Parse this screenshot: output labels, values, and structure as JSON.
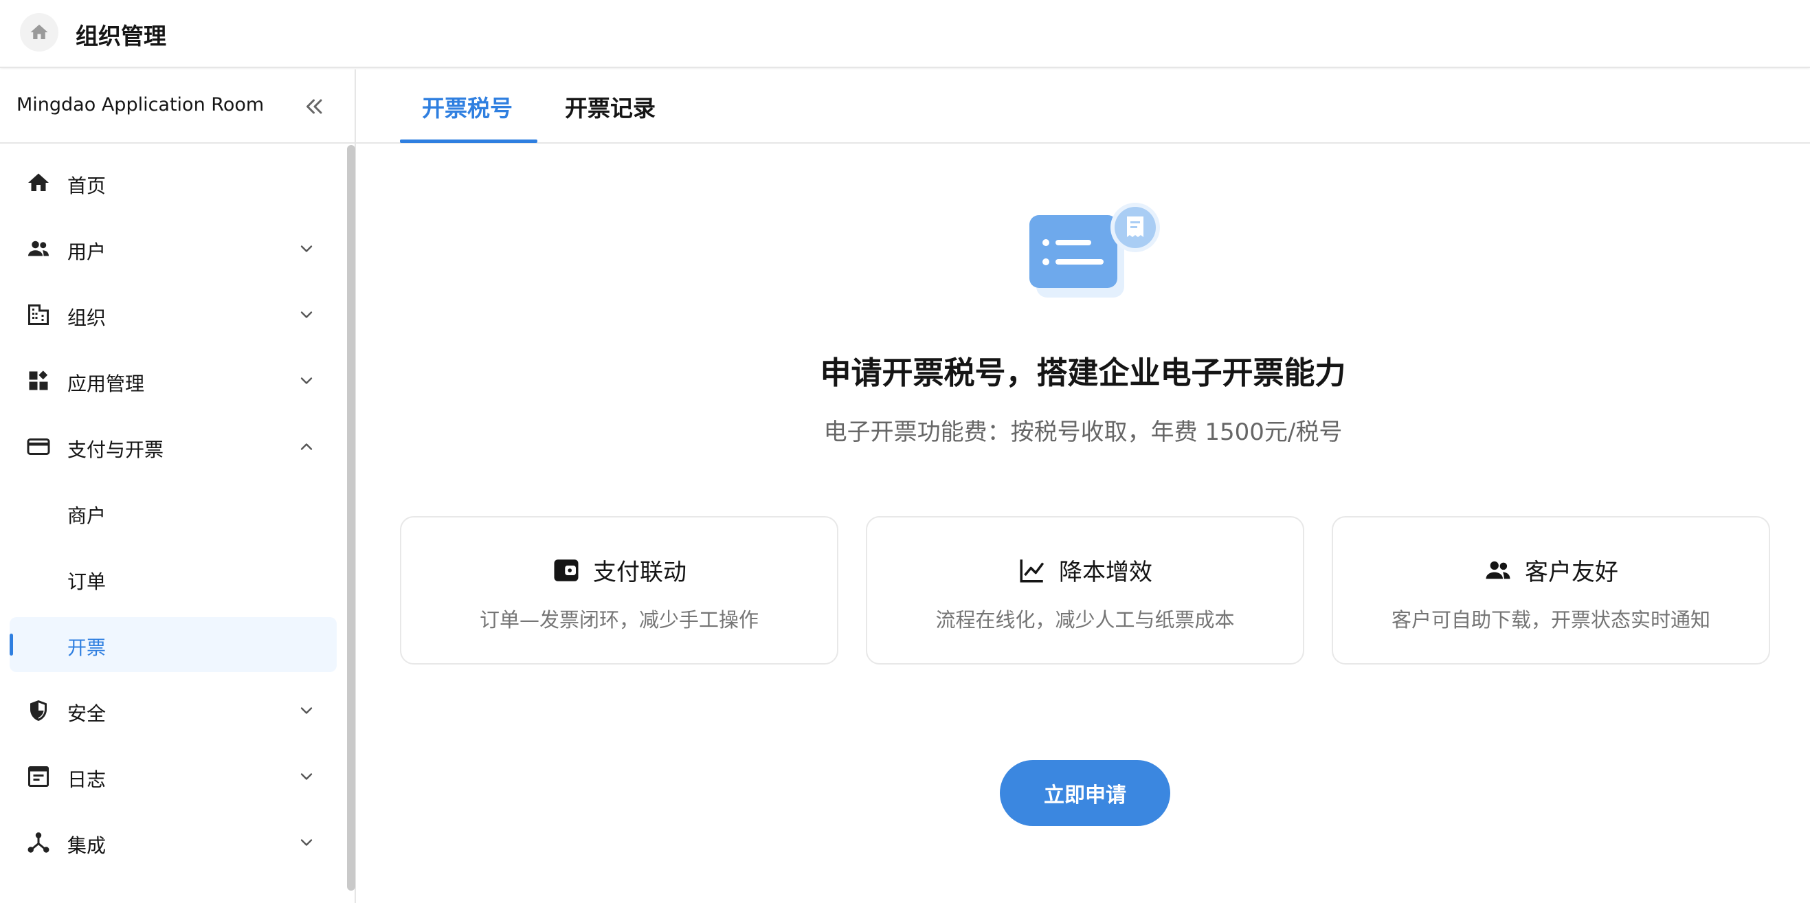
{
  "header": {
    "title": "组织管理"
  },
  "sidebar": {
    "org_name": "Mingdao Application Room",
    "items": [
      {
        "label": "首页",
        "icon": "home-icon",
        "chevron": ""
      },
      {
        "label": "用户",
        "icon": "users-icon",
        "chevron": "down"
      },
      {
        "label": "组织",
        "icon": "building-icon",
        "chevron": "down"
      },
      {
        "label": "应用管理",
        "icon": "apps-icon",
        "chevron": "down"
      },
      {
        "label": "支付与开票",
        "icon": "card-icon",
        "chevron": "up"
      },
      {
        "label": "商户",
        "icon": "",
        "chevron": ""
      },
      {
        "label": "订单",
        "icon": "",
        "chevron": ""
      },
      {
        "label": "开票",
        "icon": "",
        "chevron": "",
        "active": true
      },
      {
        "label": "安全",
        "icon": "shield-icon",
        "chevron": "down"
      },
      {
        "label": "日志",
        "icon": "log-icon",
        "chevron": "down"
      },
      {
        "label": "集成",
        "icon": "integration-icon",
        "chevron": "down"
      }
    ]
  },
  "main": {
    "tabs": [
      {
        "label": "开票税号",
        "active": true
      },
      {
        "label": "开票记录",
        "active": false
      }
    ],
    "headline": "申请开票税号，搭建企业电子开票能力",
    "subline": "电子开票功能费：按税号收取，年费 1500元/税号",
    "cards": [
      {
        "title": "支付联动",
        "desc": "订单—发票闭环，减少手工操作",
        "icon": "wallet-icon"
      },
      {
        "title": "降本增效",
        "desc": "流程在线化，减少人工与纸票成本",
        "icon": "line-chart-icon"
      },
      {
        "title": "客户友好",
        "desc": "客户可自助下载，开票状态实时通知",
        "icon": "users-icon"
      }
    ],
    "apply_button": "立即申请"
  },
  "colors": {
    "accent": "#2f7fe0",
    "active_bg": "#f0f7ff",
    "button": "#3b87e0"
  }
}
